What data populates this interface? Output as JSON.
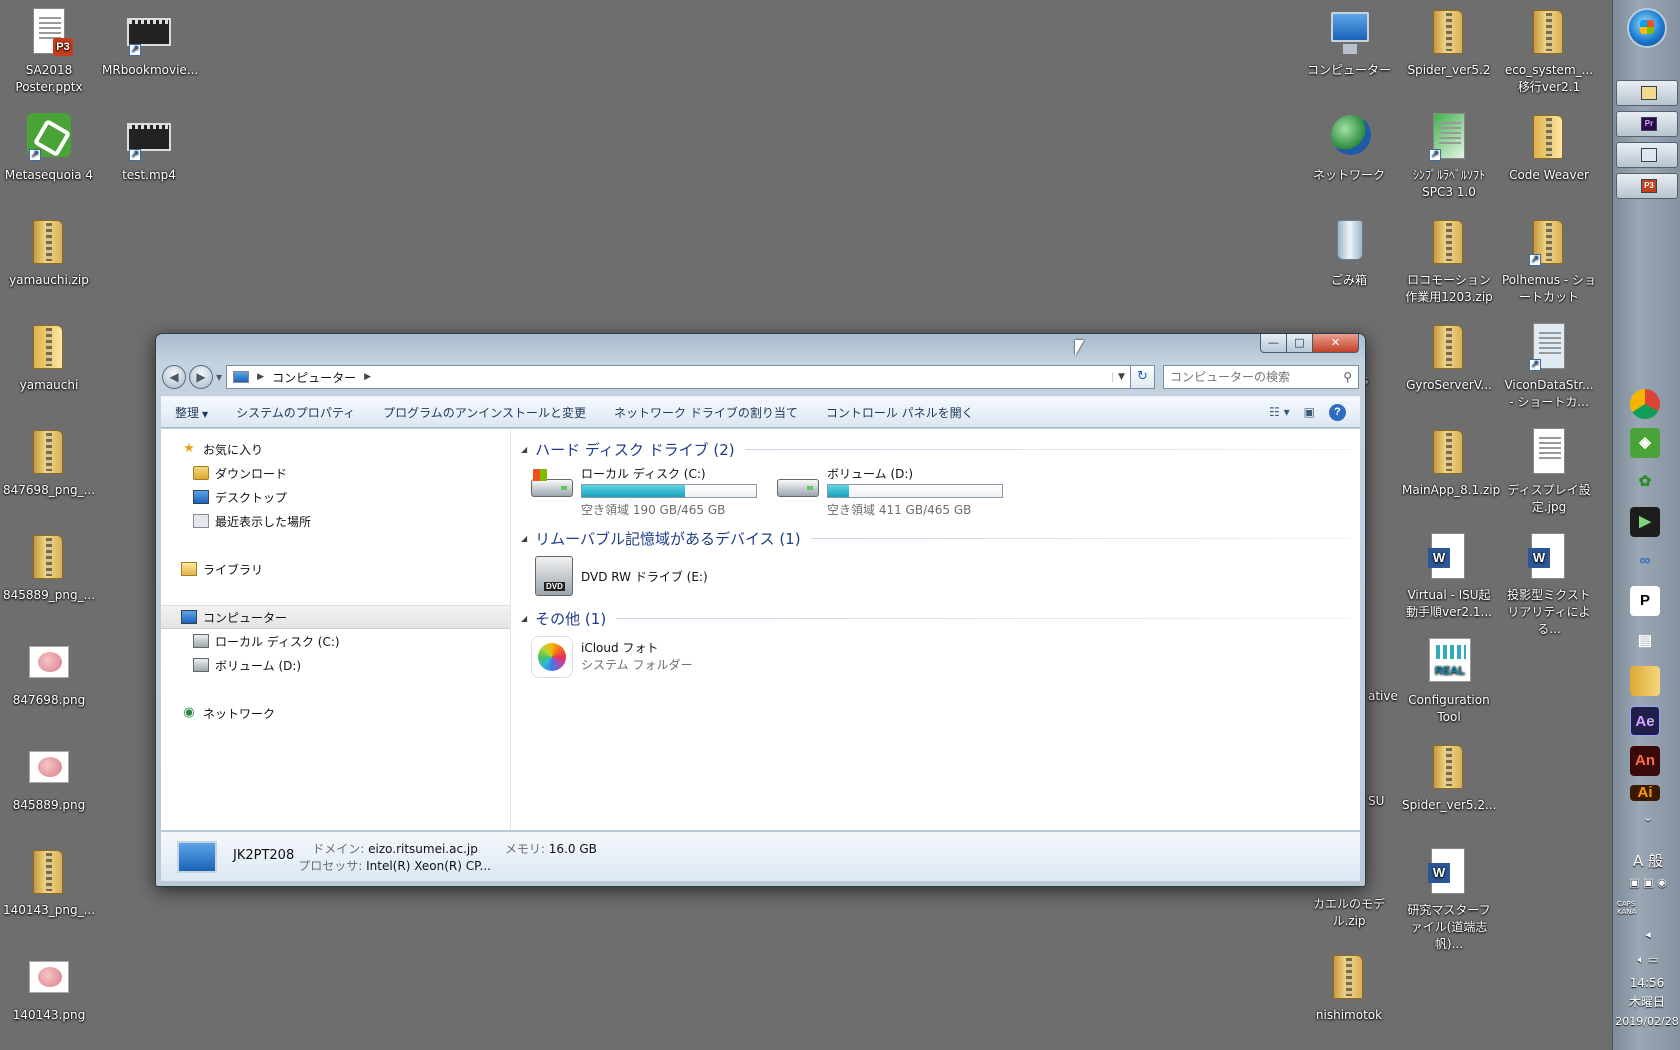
{
  "desktop": {
    "left_icons": [
      {
        "label": "SA2018 Poster.pptx",
        "badge": "P3"
      },
      {
        "label": "MRbookmovie..."
      },
      {
        "label": "Metasequoia 4"
      },
      {
        "label": "test.mp4"
      },
      {
        "label": "yamauchi.zip"
      },
      {
        "label": "yamauchi"
      },
      {
        "label": "847698_png_..."
      },
      {
        "label": "845889_png_..."
      },
      {
        "label": "847698.png"
      },
      {
        "label": "845889.png"
      },
      {
        "label": "140143_png_..."
      },
      {
        "label": "140143.png"
      }
    ],
    "right_icons": [
      {
        "label": "コンピューター"
      },
      {
        "label": "Spider_ver5.2"
      },
      {
        "label": "eco_system_... 移行ver2.1"
      },
      {
        "label": "ネットワーク"
      },
      {
        "label": "ｼﾝﾌﾟﾙﾗﾍﾞﾙｿﾌﾄ SPC3 1.0"
      },
      {
        "label": "Code Weaver"
      },
      {
        "label": "ごみ箱"
      },
      {
        "label": "ロコモーション作業用1203.zip"
      },
      {
        "label": "Polhemus - ショートカット"
      },
      {
        "label": "GyroServerV..."
      },
      {
        "label": "ViconDataStr... - ショートカ..."
      },
      {
        "label": "MainApp_8.1.zip"
      },
      {
        "label": "ディスプレイ設定.jpg"
      },
      {
        "label": "Virtual - ISU起動手順ver2.1..."
      },
      {
        "label": "投影型ミクストリアリティによる..."
      },
      {
        "label": "Configuration Tool"
      },
      {
        "label": "Spider_ver5.2..."
      },
      {
        "label": "カエルのモデル.zip"
      },
      {
        "label": "研究マスターファイル(道端志帆)..."
      },
      {
        "label": "nishimotok"
      }
    ],
    "partial_labels": [
      "s",
      "ative",
      "SU"
    ]
  },
  "explorer": {
    "address": {
      "location": "コンピューター"
    },
    "search": {
      "placeholder": "コンピューターの検索"
    },
    "commands": [
      "整理",
      "システムのプロパティ",
      "プログラムのアンインストールと変更",
      "ネットワーク ドライブの割り当て",
      "コントロール パネルを開く"
    ],
    "nav": {
      "favorites": "お気に入り",
      "downloads": "ダウンロード",
      "desktop": "デスクトップ",
      "recent": "最近表示した場所",
      "libraries": "ライブラリ",
      "computer": "コンピューター",
      "local_disk": "ローカル ディスク (C:)",
      "volume_d": "ボリューム (D:)",
      "network": "ネットワーク"
    },
    "groups": {
      "hdd": "ハード ディスク ドライブ (2)",
      "removable": "リムーバブル記憶域があるデバイス (1)",
      "other": "その他 (1)"
    },
    "drives": [
      {
        "name": "ローカル ディスク (C:)",
        "free_text": "空き領域 190 GB/465 GB",
        "used_fraction": 0.59
      },
      {
        "name": "ボリューム (D:)",
        "free_text": "空き領域 411 GB/465 GB",
        "used_fraction": 0.12
      }
    ],
    "dvd": {
      "name": "DVD RW ドライブ (E:)"
    },
    "icloud": {
      "name": "iCloud フォト",
      "sub": "システム フォルダー"
    },
    "details": {
      "pc_name": "JK2PT208",
      "domain_label": "ドメイン:",
      "domain": "eizo.ritsumei.ac.jp",
      "memory_label": "メモリ:",
      "memory": "16.0 GB",
      "cpu_label": "プロセッサ:",
      "cpu": "Intel(R) Xeon(R) CP..."
    }
  },
  "taskbar": {
    "ime": "A 般",
    "caps": "CAPS KANA",
    "clock_time": "14:56",
    "clock_day": "木曜日",
    "clock_date": "2019/02/28",
    "pins": [
      "Pr",
      "Ae",
      "An",
      "Ai",
      "P"
    ]
  }
}
